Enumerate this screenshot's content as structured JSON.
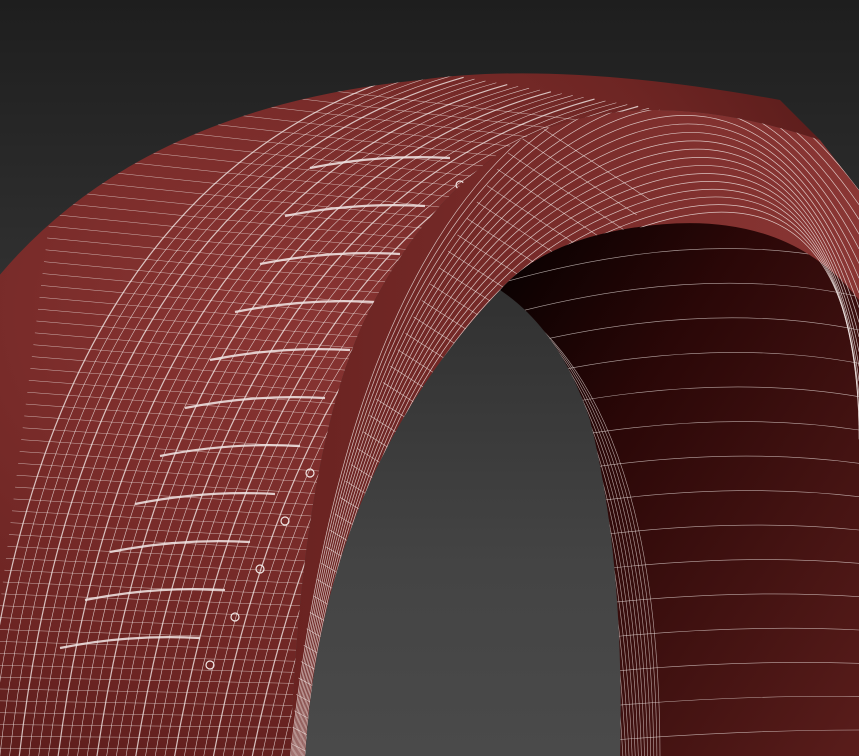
{
  "scene": {
    "subject": "tire-wireframe-render",
    "background_color_top": "#1e1e1e",
    "background_color_bottom": "#4a4a4a",
    "mesh_color": "#7a2e2c",
    "mesh_shadow_color": "#2a0707",
    "wire_color": "#f2e8e6"
  }
}
